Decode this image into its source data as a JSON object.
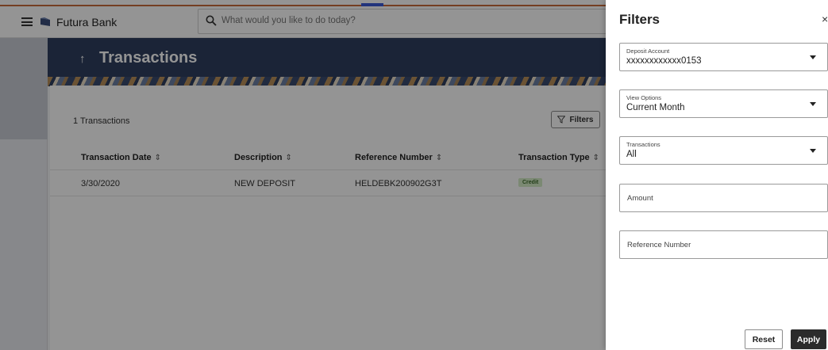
{
  "topbar": {
    "brand": "Futura Bank",
    "search_placeholder": "What would you like to do today?"
  },
  "page": {
    "back_arrow": "↑",
    "title": "Transactions"
  },
  "list": {
    "count_label": "1 Transactions",
    "filters_button": "Filters",
    "columns": [
      "Transaction Date",
      "Description",
      "Reference Number",
      "Transaction Type"
    ],
    "rows": [
      {
        "date": "3/30/2020",
        "description": "NEW DEPOSIT",
        "reference": "HELDEBK200902G3T",
        "type": "Credit"
      }
    ]
  },
  "drawer": {
    "title": "Filters",
    "close": "×",
    "deposit_account": {
      "label": "Deposit Account",
      "value": "xxxxxxxxxxxx0153"
    },
    "view_options": {
      "label": "View Options",
      "value": "Current Month"
    },
    "transactions": {
      "label": "Transactions",
      "value": "All"
    },
    "amount_placeholder": "Amount",
    "reference_placeholder": "Reference Number",
    "reset_label": "Reset",
    "apply_label": "Apply"
  },
  "colors": {
    "hero": "#2f3f60",
    "credit_badge_bg": "#d4ecc7",
    "credit_badge_text": "#3d6b2b",
    "apply_bg": "#2b2b2b"
  }
}
